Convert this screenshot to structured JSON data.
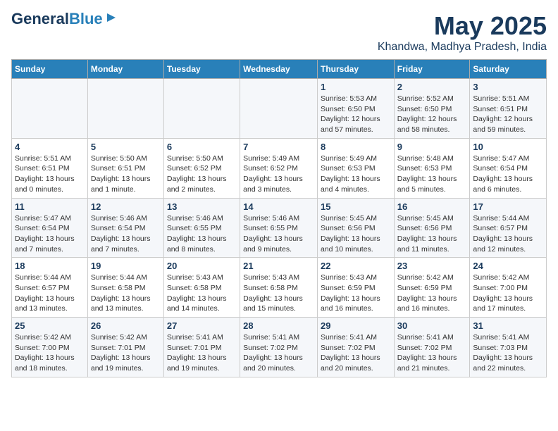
{
  "logo": {
    "line1": "General",
    "line2": "Blue"
  },
  "title": "May 2025",
  "subtitle": "Khandwa, Madhya Pradesh, India",
  "days_of_week": [
    "Sunday",
    "Monday",
    "Tuesday",
    "Wednesday",
    "Thursday",
    "Friday",
    "Saturday"
  ],
  "weeks": [
    [
      {
        "day": "",
        "info": ""
      },
      {
        "day": "",
        "info": ""
      },
      {
        "day": "",
        "info": ""
      },
      {
        "day": "",
        "info": ""
      },
      {
        "day": "1",
        "info": "Sunrise: 5:53 AM\nSunset: 6:50 PM\nDaylight: 12 hours\nand 57 minutes."
      },
      {
        "day": "2",
        "info": "Sunrise: 5:52 AM\nSunset: 6:50 PM\nDaylight: 12 hours\nand 58 minutes."
      },
      {
        "day": "3",
        "info": "Sunrise: 5:51 AM\nSunset: 6:51 PM\nDaylight: 12 hours\nand 59 minutes."
      }
    ],
    [
      {
        "day": "4",
        "info": "Sunrise: 5:51 AM\nSunset: 6:51 PM\nDaylight: 13 hours\nand 0 minutes."
      },
      {
        "day": "5",
        "info": "Sunrise: 5:50 AM\nSunset: 6:51 PM\nDaylight: 13 hours\nand 1 minute."
      },
      {
        "day": "6",
        "info": "Sunrise: 5:50 AM\nSunset: 6:52 PM\nDaylight: 13 hours\nand 2 minutes."
      },
      {
        "day": "7",
        "info": "Sunrise: 5:49 AM\nSunset: 6:52 PM\nDaylight: 13 hours\nand 3 minutes."
      },
      {
        "day": "8",
        "info": "Sunrise: 5:49 AM\nSunset: 6:53 PM\nDaylight: 13 hours\nand 4 minutes."
      },
      {
        "day": "9",
        "info": "Sunrise: 5:48 AM\nSunset: 6:53 PM\nDaylight: 13 hours\nand 5 minutes."
      },
      {
        "day": "10",
        "info": "Sunrise: 5:47 AM\nSunset: 6:54 PM\nDaylight: 13 hours\nand 6 minutes."
      }
    ],
    [
      {
        "day": "11",
        "info": "Sunrise: 5:47 AM\nSunset: 6:54 PM\nDaylight: 13 hours\nand 7 minutes."
      },
      {
        "day": "12",
        "info": "Sunrise: 5:46 AM\nSunset: 6:54 PM\nDaylight: 13 hours\nand 7 minutes."
      },
      {
        "day": "13",
        "info": "Sunrise: 5:46 AM\nSunset: 6:55 PM\nDaylight: 13 hours\nand 8 minutes."
      },
      {
        "day": "14",
        "info": "Sunrise: 5:46 AM\nSunset: 6:55 PM\nDaylight: 13 hours\nand 9 minutes."
      },
      {
        "day": "15",
        "info": "Sunrise: 5:45 AM\nSunset: 6:56 PM\nDaylight: 13 hours\nand 10 minutes."
      },
      {
        "day": "16",
        "info": "Sunrise: 5:45 AM\nSunset: 6:56 PM\nDaylight: 13 hours\nand 11 minutes."
      },
      {
        "day": "17",
        "info": "Sunrise: 5:44 AM\nSunset: 6:57 PM\nDaylight: 13 hours\nand 12 minutes."
      }
    ],
    [
      {
        "day": "18",
        "info": "Sunrise: 5:44 AM\nSunset: 6:57 PM\nDaylight: 13 hours\nand 13 minutes."
      },
      {
        "day": "19",
        "info": "Sunrise: 5:44 AM\nSunset: 6:58 PM\nDaylight: 13 hours\nand 13 minutes."
      },
      {
        "day": "20",
        "info": "Sunrise: 5:43 AM\nSunset: 6:58 PM\nDaylight: 13 hours\nand 14 minutes."
      },
      {
        "day": "21",
        "info": "Sunrise: 5:43 AM\nSunset: 6:58 PM\nDaylight: 13 hours\nand 15 minutes."
      },
      {
        "day": "22",
        "info": "Sunrise: 5:43 AM\nSunset: 6:59 PM\nDaylight: 13 hours\nand 16 minutes."
      },
      {
        "day": "23",
        "info": "Sunrise: 5:42 AM\nSunset: 6:59 PM\nDaylight: 13 hours\nand 16 minutes."
      },
      {
        "day": "24",
        "info": "Sunrise: 5:42 AM\nSunset: 7:00 PM\nDaylight: 13 hours\nand 17 minutes."
      }
    ],
    [
      {
        "day": "25",
        "info": "Sunrise: 5:42 AM\nSunset: 7:00 PM\nDaylight: 13 hours\nand 18 minutes."
      },
      {
        "day": "26",
        "info": "Sunrise: 5:42 AM\nSunset: 7:01 PM\nDaylight: 13 hours\nand 19 minutes."
      },
      {
        "day": "27",
        "info": "Sunrise: 5:41 AM\nSunset: 7:01 PM\nDaylight: 13 hours\nand 19 minutes."
      },
      {
        "day": "28",
        "info": "Sunrise: 5:41 AM\nSunset: 7:02 PM\nDaylight: 13 hours\nand 20 minutes."
      },
      {
        "day": "29",
        "info": "Sunrise: 5:41 AM\nSunset: 7:02 PM\nDaylight: 13 hours\nand 20 minutes."
      },
      {
        "day": "30",
        "info": "Sunrise: 5:41 AM\nSunset: 7:02 PM\nDaylight: 13 hours\nand 21 minutes."
      },
      {
        "day": "31",
        "info": "Sunrise: 5:41 AM\nSunset: 7:03 PM\nDaylight: 13 hours\nand 22 minutes."
      }
    ]
  ]
}
